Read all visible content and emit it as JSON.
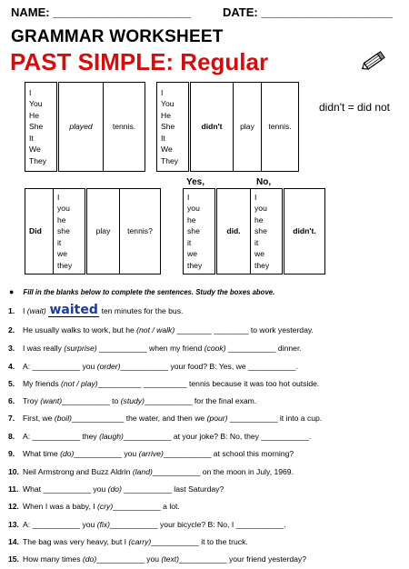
{
  "header": {
    "name_label": "NAME: _____________________",
    "date_label": "DATE: ____________________",
    "title": "GRAMMAR WORKSHEET",
    "subtitle": "PAST SIMPLE: Regular"
  },
  "note": "didn't = did not",
  "table1": {
    "subjects": "I\nYou\nHe\nShe\nIt\nWe\nThey",
    "verb": "played",
    "object": "tennis."
  },
  "table2": {
    "subjects": "I\nYou\nHe\nShe\nIt\nWe\nThey",
    "aux": "didn't",
    "verb": "play",
    "object": "tennis."
  },
  "table3": {
    "aux": "Did",
    "subjects": "I\nyou\nhe\nshe\nit\nwe\nthey",
    "verb": "play",
    "object": "tennis?"
  },
  "table4": {
    "yes_label": "Yes,",
    "no_label": "No,",
    "yes_subjects": "I\nyou\nhe\nshe\nit\nwe\nthey",
    "yes_aux": "did.",
    "no_subjects": "I\nyou\nhe\nshe\nit\nwe\nthey",
    "no_aux": "didn't."
  },
  "instructions": "Fill in the blanks below to complete the sentences.  Study the boxes above.",
  "sentences": [
    {
      "num": "1.",
      "pre": "I ",
      "hint": "(wait)",
      "answer": "waited",
      "post": " ten minutes for the bus."
    },
    {
      "num": "2.",
      "text": "He usually walks to work, but he (not / walk) ________ ________ to work yesterday."
    },
    {
      "num": "3.",
      "text": "I was really (surprise) ___________ when my friend (cook) ___________ dinner."
    },
    {
      "num": "4.",
      "text": "A: ___________ you (order)___________ your food?   B: Yes, we ___________."
    },
    {
      "num": "5.",
      "text": "My friends (not / play)__________ __________ tennis because it was too hot outside."
    },
    {
      "num": "6.",
      "text": "Troy (want)___________ to (study)___________ for the final exam."
    },
    {
      "num": "7.",
      "text": "First, we (boil)____________ the water, and then we (pour) ___________ it into a cup."
    },
    {
      "num": "8.",
      "text": "A: ___________ they (laugh)___________ at your joke?   B: No, they ___________."
    },
    {
      "num": "9.",
      "text": "What time (do)___________ you (arrive)___________ at school this morning?"
    },
    {
      "num": "10.",
      "text": "Neil Armstrong and Buzz Aldrin (land)___________ on the moon in July, 1969."
    },
    {
      "num": "11.",
      "text": "What ___________ you (do) ___________ last Saturday?"
    },
    {
      "num": "12.",
      "text": "When I was a baby, I (cry)___________ a lot."
    },
    {
      "num": "13.",
      "text": "A: ___________ you (fix)___________ your bicycle?   B: No, I ___________."
    },
    {
      "num": "14.",
      "text": "The bag was very heavy, but I (carry)___________ it to the truck."
    },
    {
      "num": "15.",
      "text": "How many times (do)___________ you (text)___________ your friend yesterday?"
    }
  ]
}
